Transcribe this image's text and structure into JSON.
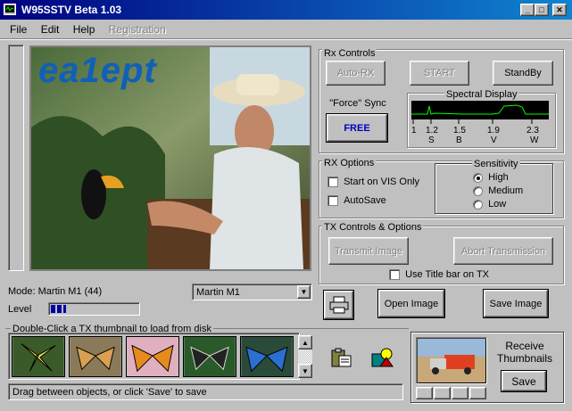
{
  "window": {
    "title": "W95SSTV Beta 1.03"
  },
  "menu": {
    "file": "File",
    "edit": "Edit",
    "help": "Help",
    "registration": "Registration"
  },
  "image": {
    "callsign": "ea1ept"
  },
  "mode": {
    "label": "Mode: Martin M1 (44)",
    "selected": "Martin M1",
    "level_label": "Level",
    "level": 0.18
  },
  "rx": {
    "title": "Rx Controls",
    "autorx": "Auto-RX",
    "start": "START",
    "standby": "StandBy",
    "force_sync": "\"Force\" Sync",
    "free": "FREE",
    "spectral_title": "Spectral Display",
    "ticks": [
      "1",
      "1.2",
      "1.5",
      "1.9",
      "2.3"
    ],
    "tick_letters": [
      "S",
      "B",
      "V",
      "W"
    ]
  },
  "rx_options": {
    "title": "RX Options",
    "start_vis": "Start on VIS Only",
    "autosave": "AutoSave"
  },
  "sensitivity": {
    "title": "Sensitivity",
    "high": "High",
    "medium": "Medium",
    "low": "Low",
    "selected": "High"
  },
  "tx": {
    "title": "TX Controls & Options",
    "transmit": "Transmit Image",
    "abort": "Abort Transmission",
    "title_bar": "Use Title bar on TX"
  },
  "buttons": {
    "open_image": "Open Image",
    "save_image": "Save Image",
    "save": "Save"
  },
  "thumbs": {
    "title": "Double-Click a TX thumbnail to load from disk",
    "status": "Drag between objects, or click 'Save' to save"
  },
  "receive": {
    "label1": "Receive",
    "label2": "Thumbnails"
  },
  "colors": {
    "title_start": "#000080",
    "title_end": "#1084d0",
    "level_fill": "#0000a8",
    "spectral_line": "#00ff00",
    "callsign": "#1060b8"
  }
}
